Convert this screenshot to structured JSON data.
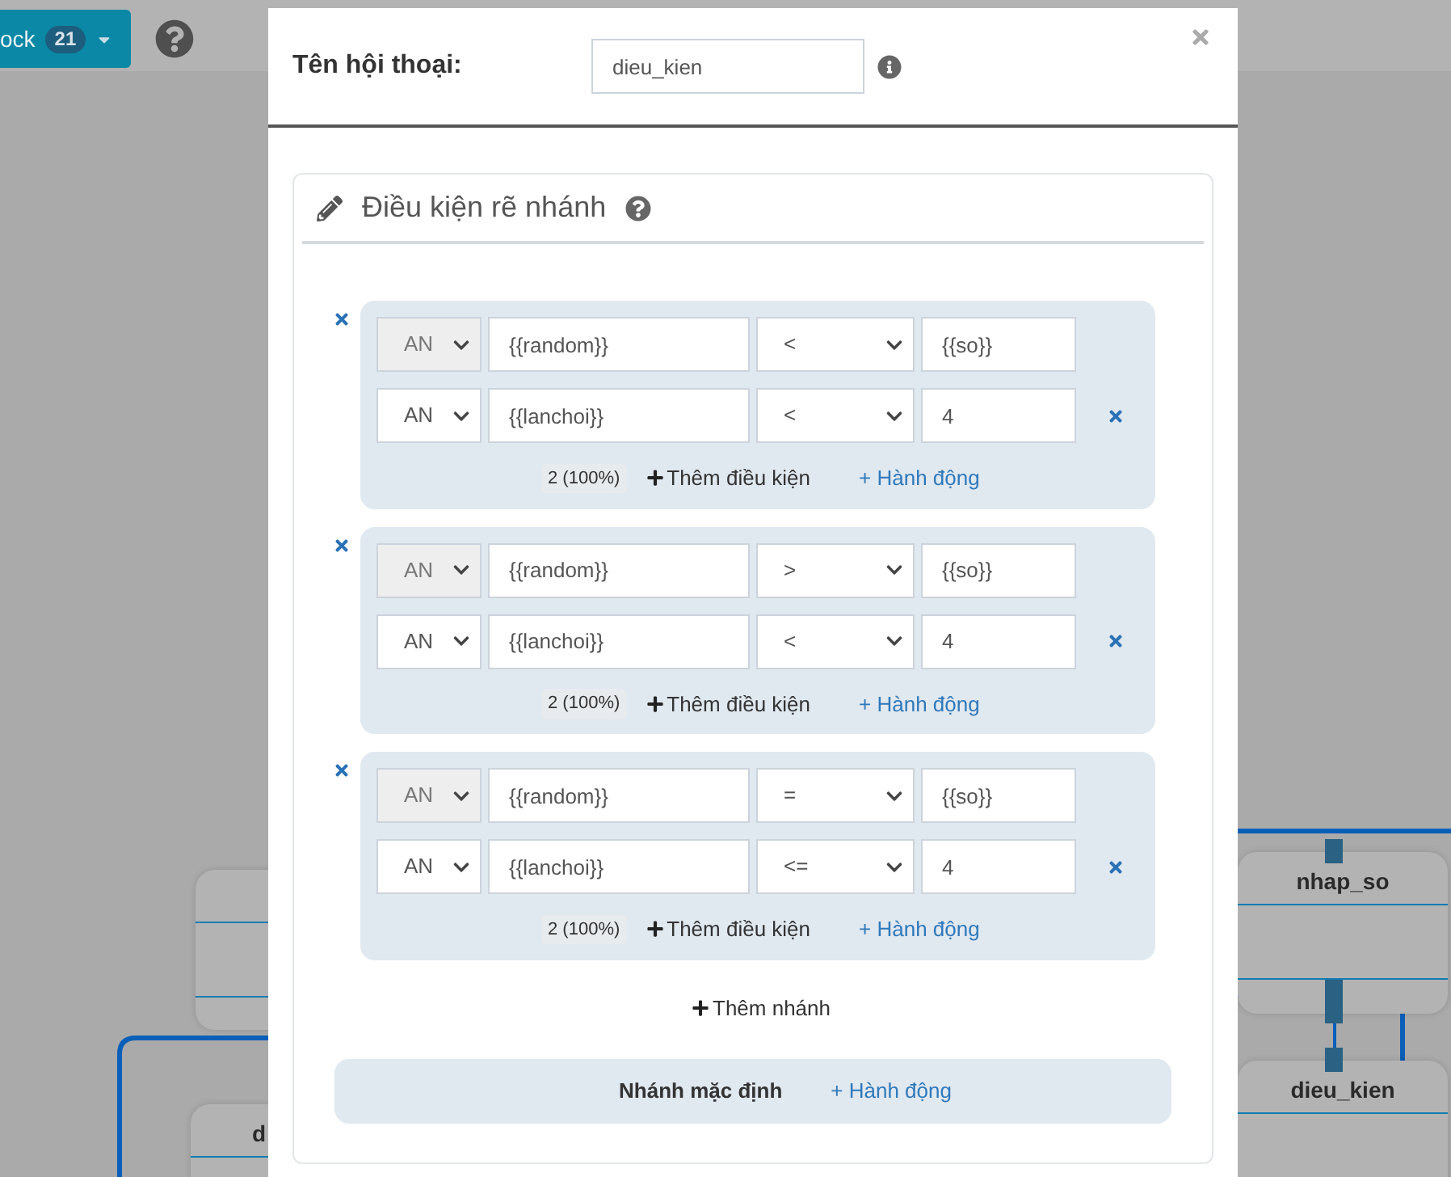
{
  "toolbar": {
    "block_button": {
      "label": "ock",
      "count": "21"
    }
  },
  "canvas": {
    "nodes": [
      {
        "title": "d"
      },
      {
        "title": "nhap_so"
      },
      {
        "title": "dieu_kien"
      }
    ]
  },
  "dialog": {
    "name_label": "Tên hội thoại:",
    "name_value": "dieu_kien",
    "section_title": "Điều kiện rẽ nhánh",
    "branches": [
      {
        "conditions": [
          {
            "logic": "AN",
            "disabled": true,
            "variable": "{{random}}",
            "operator": "<",
            "value": "{{so}}",
            "removable": false
          },
          {
            "logic": "AN",
            "disabled": false,
            "variable": "{{lanchoi}}",
            "operator": "<",
            "value": "4",
            "removable": true
          }
        ],
        "count": "2 (100%)",
        "add_condition": "Thêm điều kiện",
        "add_action": "+ Hành động"
      },
      {
        "conditions": [
          {
            "logic": "AN",
            "disabled": true,
            "variable": "{{random}}",
            "operator": ">",
            "value": "{{so}}",
            "removable": false
          },
          {
            "logic": "AN",
            "disabled": false,
            "variable": "{{lanchoi}}",
            "operator": "<",
            "value": "4",
            "removable": true
          }
        ],
        "count": "2 (100%)",
        "add_condition": "Thêm điều kiện",
        "add_action": "+ Hành động"
      },
      {
        "conditions": [
          {
            "logic": "AN",
            "disabled": true,
            "variable": "{{random}}",
            "operator": "=",
            "value": "{{so}}",
            "removable": false
          },
          {
            "logic": "AN",
            "disabled": false,
            "variable": "{{lanchoi}}",
            "operator": "<=",
            "value": "4",
            "removable": true
          }
        ],
        "count": "2 (100%)",
        "add_condition": "Thêm điều kiện",
        "add_action": "+ Hành động"
      }
    ],
    "add_branch": "Thêm nhánh",
    "default_branch": {
      "label": "Nhánh mặc định",
      "add_action": "+ Hành động"
    }
  }
}
